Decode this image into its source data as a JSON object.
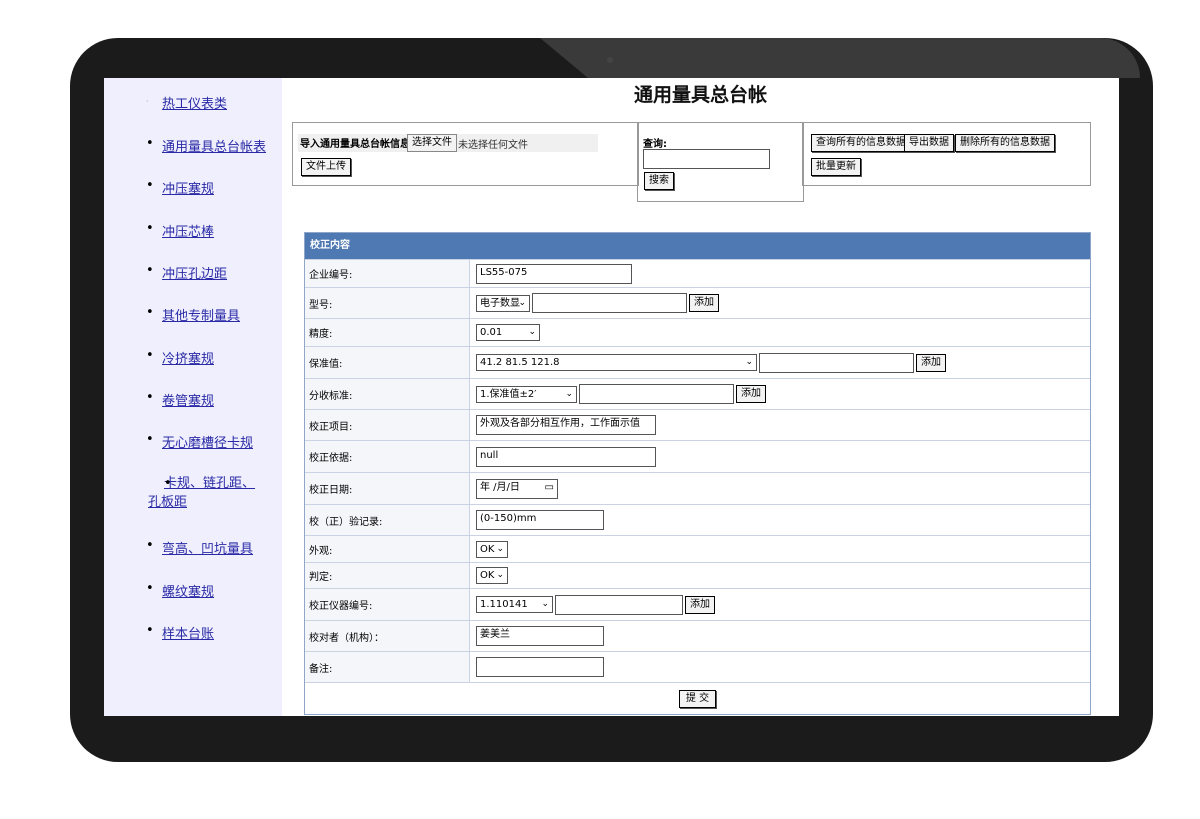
{
  "sidebar": {
    "items": [
      {
        "label": "热工仪表类"
      },
      {
        "label": "通用量具总台帐表"
      },
      {
        "label": "冲压塞规"
      },
      {
        "label": "冲压芯棒"
      },
      {
        "label": "冲压孔边距"
      },
      {
        "label": "其他专制量具"
      },
      {
        "label": "冷挤塞规"
      },
      {
        "label": "卷管塞规"
      },
      {
        "label": "无心磨槽径卡规"
      },
      {
        "label": "卡规、链孔距、孔板距"
      },
      {
        "label": "弯高、凹坑量具"
      },
      {
        "label": "螺纹塞规"
      },
      {
        "label": "样本台账"
      }
    ]
  },
  "header": {
    "title": "通用量具总台帐"
  },
  "import": {
    "label": "导入通用量具总台帐信息：",
    "choose_file": "选择文件",
    "no_file": "未选择任何文件",
    "upload": "文件上传"
  },
  "search": {
    "label": "查询:",
    "value": "",
    "button": "搜索"
  },
  "actions": {
    "query_all": "查询所有的信息数据",
    "export": "导出数据",
    "delete_all": "删除所有的信息数据",
    "batch_update": "批量更新"
  },
  "form": {
    "section_title": "校正内容",
    "company_no_label": "企业编号:",
    "company_no_value": "LS55-075",
    "model_label": "型号:",
    "model_select": "电子数显",
    "add": "添加",
    "precision_label": "精度:",
    "precision_select": "0.01",
    "warranty_label": "保准值:",
    "warranty_select": "41.2 81.5 121.8",
    "acceptance_label": "分收标准:",
    "acceptance_select": "1.保准值±2′",
    "item_label": "校正项目:",
    "item_value": "外观及各部分相互作用，工作面示值",
    "basis_label": "校正依据:",
    "basis_value": "null",
    "date_label": "校正日期:",
    "date_value": "年 /月/日",
    "record_label": "校（正）验记录:",
    "record_value": "(0-150)mm",
    "appearance_label": "外观:",
    "appearance_select": "OK",
    "judge_label": "判定:",
    "judge_select": "OK",
    "instrument_label": "校正仪器编号:",
    "instrument_select": "1.110141",
    "checker_label": "校对者（机构）：",
    "checker_value": "姜美兰",
    "remark_label": "备注:",
    "remark_value": "",
    "submit": "提  交"
  }
}
